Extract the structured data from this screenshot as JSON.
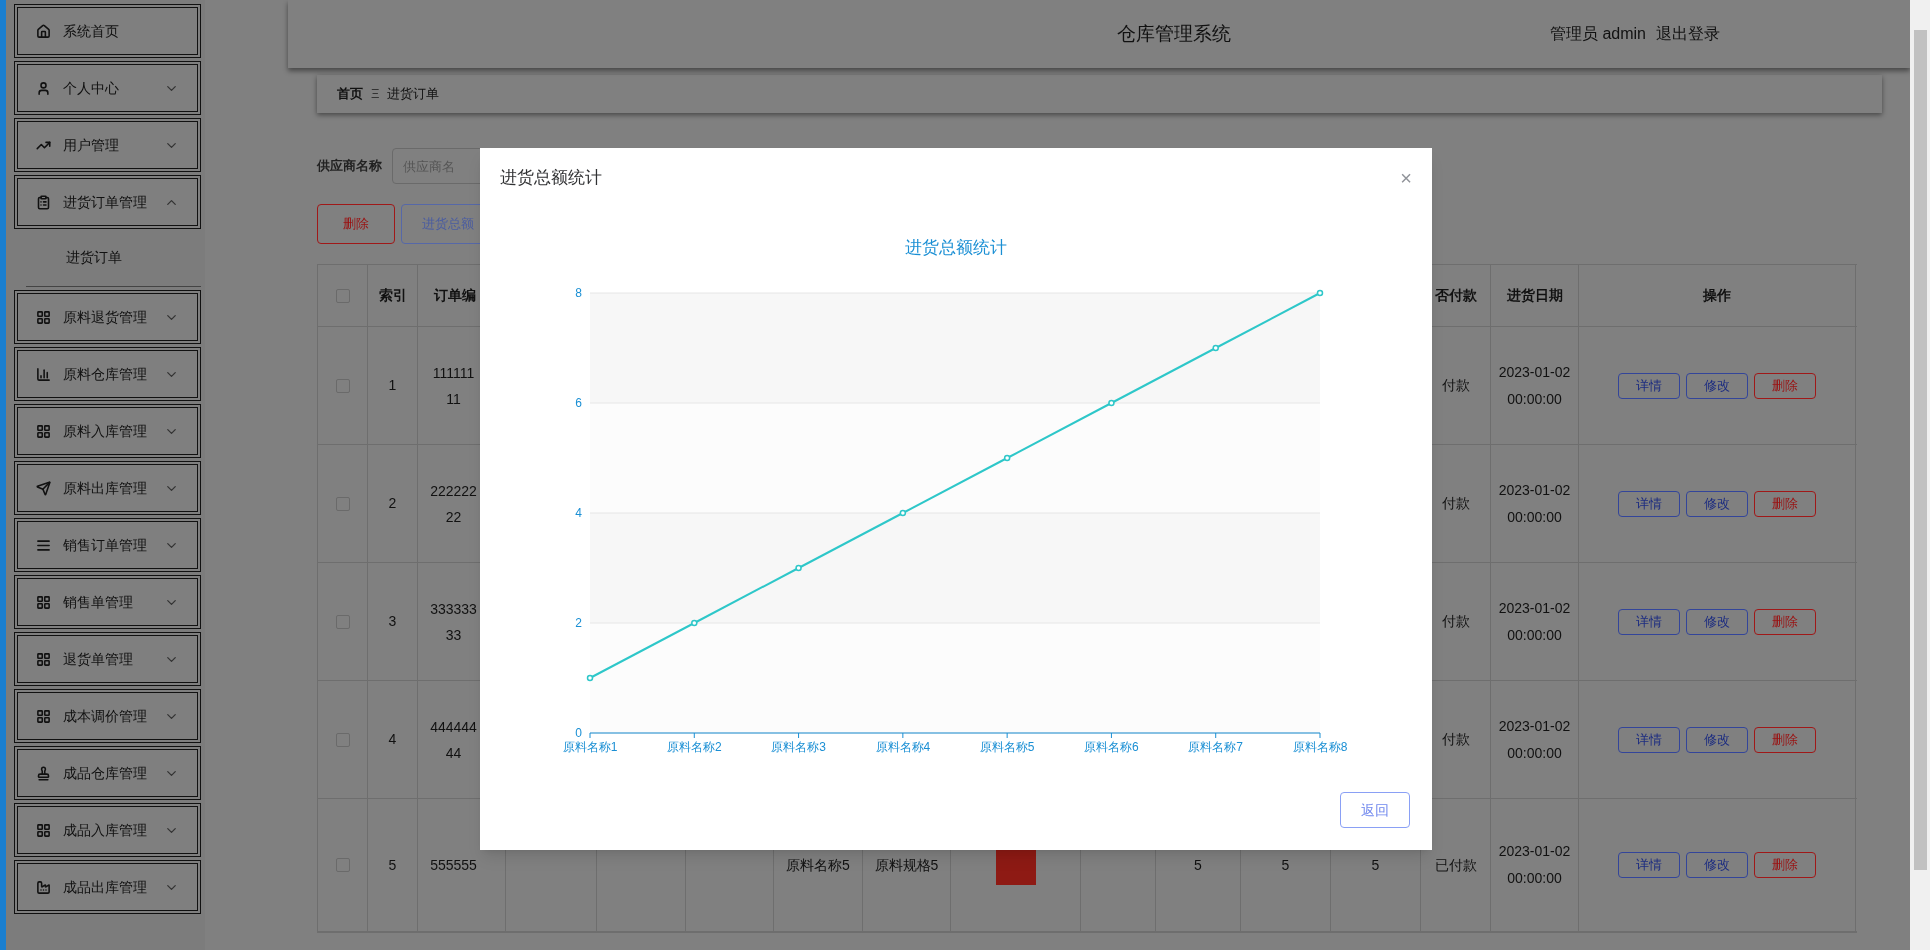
{
  "sidebar": {
    "items": [
      {
        "label": "系统首页"
      },
      {
        "label": "个人中心",
        "expanded": false
      },
      {
        "label": "用户管理",
        "expanded": false
      },
      {
        "label": "进货订单管理",
        "expanded": true,
        "children": [
          {
            "label": "进货订单"
          }
        ]
      },
      {
        "label": "原料退货管理",
        "expanded": false
      },
      {
        "label": "原料仓库管理",
        "expanded": false
      },
      {
        "label": "原料入库管理",
        "expanded": false
      },
      {
        "label": "原料出库管理",
        "expanded": false
      },
      {
        "label": "销售订单管理",
        "expanded": false
      },
      {
        "label": "销售单管理",
        "expanded": false
      },
      {
        "label": "退货单管理",
        "expanded": false
      },
      {
        "label": "成本调价管理",
        "expanded": false
      },
      {
        "label": "成品仓库管理",
        "expanded": false
      },
      {
        "label": "成品入库管理",
        "expanded": false
      },
      {
        "label": "成品出库管理",
        "expanded": false
      }
    ]
  },
  "header": {
    "title": "仓库管理系统",
    "user_role": "管理员",
    "username": "admin",
    "logout": "退出登录"
  },
  "breadcrumb": {
    "items": [
      "首页",
      "进货订单"
    ],
    "separator": "Ξ"
  },
  "search": {
    "label": "供应商名称",
    "placeholder": "供应商名"
  },
  "toolbar": {
    "buttons": [
      {
        "label": "删除",
        "kind": "danger"
      },
      {
        "label": "进货总额",
        "kind": "primary"
      }
    ]
  },
  "table": {
    "all_selected": false,
    "columns": {
      "index": "索引",
      "order_no": "订单编",
      "payment": "否付款",
      "date": "进货日期",
      "actions": "操作"
    },
    "rows": [
      {
        "selected": false,
        "index": "1",
        "order_no": [
          "111111",
          "11"
        ],
        "payment": "付款",
        "date": "2023-01-02 00:00:00",
        "actions": [
          {
            "label": "详情",
            "kind": "detail"
          },
          {
            "label": "修改",
            "kind": "edit"
          },
          {
            "label": "删除",
            "kind": "delete"
          }
        ]
      },
      {
        "selected": false,
        "index": "2",
        "order_no": [
          "222222",
          "22"
        ],
        "payment": "付款",
        "date": "2023-01-02 00:00:00",
        "actions": [
          {
            "label": "详情",
            "kind": "detail"
          },
          {
            "label": "修改",
            "kind": "edit"
          },
          {
            "label": "删除",
            "kind": "delete"
          }
        ]
      },
      {
        "selected": false,
        "index": "3",
        "order_no": [
          "333333",
          "33"
        ],
        "payment": "付款",
        "date": "2023-01-02 00:00:00",
        "actions": [
          {
            "label": "详情",
            "kind": "detail"
          },
          {
            "label": "修改",
            "kind": "edit"
          },
          {
            "label": "删除",
            "kind": "delete"
          }
        ]
      },
      {
        "selected": false,
        "index": "4",
        "order_no": [
          "444444",
          "44"
        ],
        "payment": "付款",
        "date": "2023-01-02 00:00:00",
        "actions": [
          {
            "label": "详情",
            "kind": "detail"
          },
          {
            "label": "修改",
            "kind": "edit"
          },
          {
            "label": "删除",
            "kind": "delete"
          }
        ]
      },
      {
        "selected": false,
        "index": "5",
        "order_no": [
          "555555"
        ],
        "column_7": "原料名称5",
        "column_8": "原料规格5",
        "column_11": "5",
        "column_12": "5",
        "column_13": "5",
        "payment": "已付款",
        "date": "2023-01-02 00:00:00",
        "actions": [
          {
            "label": "详情",
            "kind": "detail"
          },
          {
            "label": "修改",
            "kind": "edit"
          },
          {
            "label": "删除",
            "kind": "delete"
          }
        ]
      }
    ]
  },
  "dialog": {
    "title": "进货总额统计",
    "close": "×",
    "button": "返回",
    "chart_data": {
      "type": "line",
      "title": "进货总额统计",
      "categories": [
        "原料名称1",
        "原料名称2",
        "原料名称3",
        "原料名称4",
        "原料名称5",
        "原料名称6",
        "原料名称7",
        "原料名称8"
      ],
      "series": [
        {
          "color": "#2ec7c9",
          "marker": true,
          "values": [
            1,
            2,
            3,
            4,
            5,
            6,
            7,
            8
          ]
        }
      ],
      "grid": true,
      "ylim": [
        0,
        8
      ],
      "yticks": [
        0,
        2,
        4,
        6,
        8
      ]
    }
  }
}
